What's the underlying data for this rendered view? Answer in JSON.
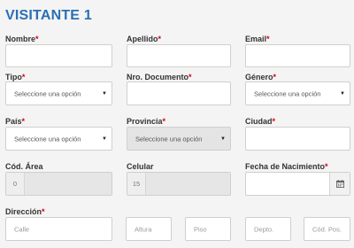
{
  "section": {
    "title": "VISITANTE 1"
  },
  "fields": {
    "nombre": {
      "label": "Nombre",
      "value": ""
    },
    "apellido": {
      "label": "Apellido",
      "value": ""
    },
    "email": {
      "label": "Email",
      "value": ""
    },
    "tipo": {
      "label": "Tipo",
      "selected": "Seleccione una opción"
    },
    "nro_documento": {
      "label": "Nro. Documento",
      "value": ""
    },
    "genero": {
      "label": "Género",
      "selected": "Seleccione una opción"
    },
    "pais": {
      "label": "País",
      "selected": "Seleccione una opción"
    },
    "provincia": {
      "label": "Provincia",
      "selected": "Seleccione una opción",
      "disabled": true
    },
    "ciudad": {
      "label": "Ciudad",
      "value": ""
    },
    "cod_area": {
      "label": "Cód. Área",
      "prefix": "0"
    },
    "celular": {
      "label": "Celular",
      "prefix": "15"
    },
    "fecha_nacimiento": {
      "label": "Fecha de Nacimiento",
      "value": ""
    },
    "direccion": {
      "label": "Dirección",
      "calle_placeholder": "Calle",
      "altura_placeholder": "Altura",
      "piso_placeholder": "Piso",
      "depto_placeholder": "Depto.",
      "cod_pos_placeholder": "Cód. Pos."
    }
  },
  "required_marker": "*",
  "icons": {
    "calendar": "calendar-icon",
    "caret": "caret-down-icon"
  },
  "colors": {
    "title": "#2a6fb5",
    "required": "#d0021b",
    "background": "#f4f4f4"
  }
}
